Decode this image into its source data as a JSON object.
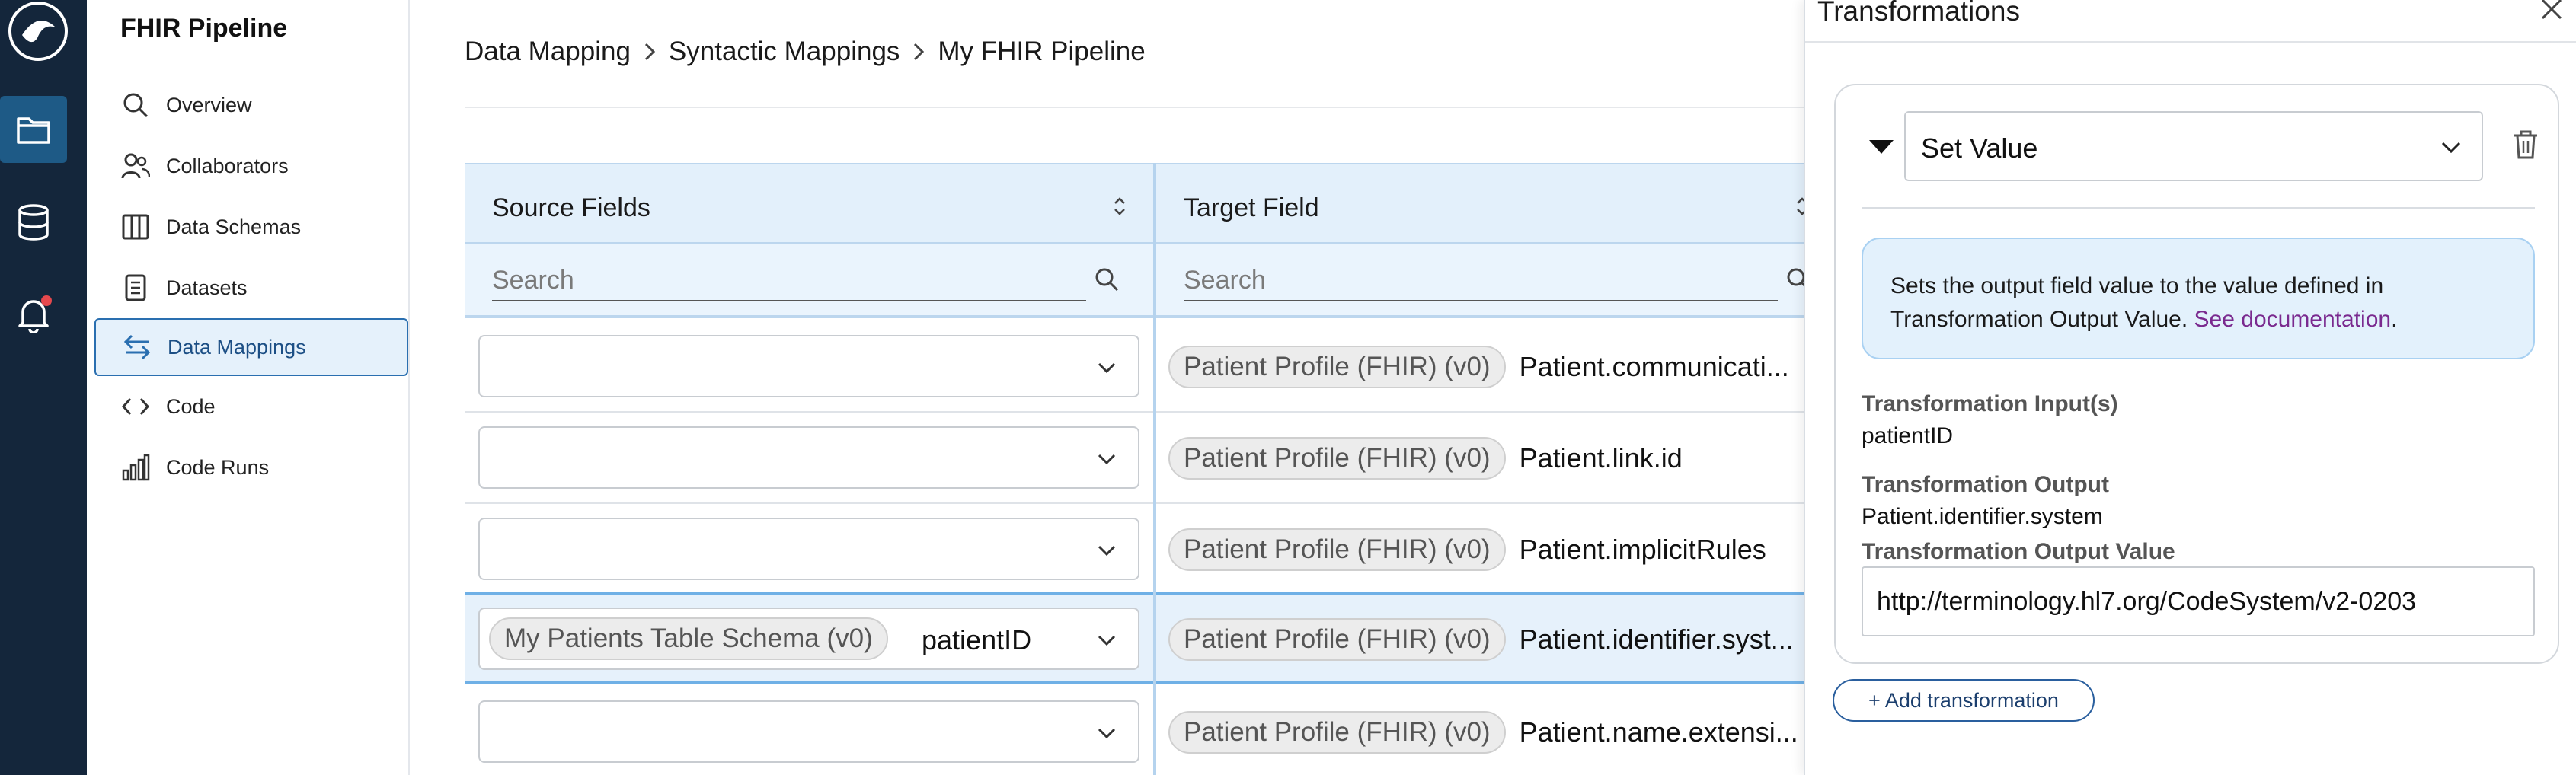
{
  "sidebar": {
    "app_title": "FHIR Pipeline",
    "items": [
      {
        "label": "Overview",
        "icon": "search-icon"
      },
      {
        "label": "Collaborators",
        "icon": "people-icon"
      },
      {
        "label": "Data Schemas",
        "icon": "columns-icon"
      },
      {
        "label": "Datasets",
        "icon": "document-icon"
      },
      {
        "label": "Data Mappings",
        "icon": "arrows-icon",
        "active": true
      },
      {
        "label": "Code",
        "icon": "code-icon"
      },
      {
        "label": "Code Runs",
        "icon": "bar-chart-icon"
      }
    ]
  },
  "rail": {
    "icons": [
      "logo-icon",
      "folder-icon",
      "database-icon",
      "bell-icon"
    ],
    "accent": "#1e5a86",
    "background": "#14263b"
  },
  "breadcrumb": [
    "Data Mapping",
    "Syntactic Mappings",
    "My FHIR Pipeline"
  ],
  "table": {
    "source_header": "Source Fields",
    "target_header": "Target Field",
    "source_search_placeholder": "Search",
    "target_search_placeholder": "Search",
    "rows": [
      {
        "source_chip": "",
        "source_field": "",
        "target_chip": "Patient Profile (FHIR) (v0)",
        "target_field": "Patient.communicati..."
      },
      {
        "source_chip": "",
        "source_field": "",
        "target_chip": "Patient Profile (FHIR) (v0)",
        "target_field": "Patient.link.id"
      },
      {
        "source_chip": "",
        "source_field": "",
        "target_chip": "Patient Profile (FHIR) (v0)",
        "target_field": "Patient.implicitRules"
      },
      {
        "source_chip": "My Patients Table Schema (v0)",
        "source_field": "patientID",
        "target_chip": "Patient Profile (FHIR) (v0)",
        "target_field": "Patient.identifier.syst...",
        "selected": true
      },
      {
        "source_chip": "",
        "source_field": "",
        "target_chip": "Patient Profile (FHIR) (v0)",
        "target_field": "Patient.name.extensi..."
      }
    ]
  },
  "panel": {
    "title": "Transformations",
    "transformation_type": "Set Value",
    "info_text": "Sets the output field value to the value defined in Transformation Output Value.",
    "info_link": "See documentation",
    "info_period": ".",
    "input_label": "Transformation Input(s)",
    "input_value": "patientID",
    "output_label": "Transformation Output",
    "output_value": "Patient.identifier.system",
    "output_value_label": "Transformation Output Value",
    "output_value_input": "http://terminology.hl7.org/CodeSystem/v2-0203",
    "add_button": "+ Add transformation"
  }
}
